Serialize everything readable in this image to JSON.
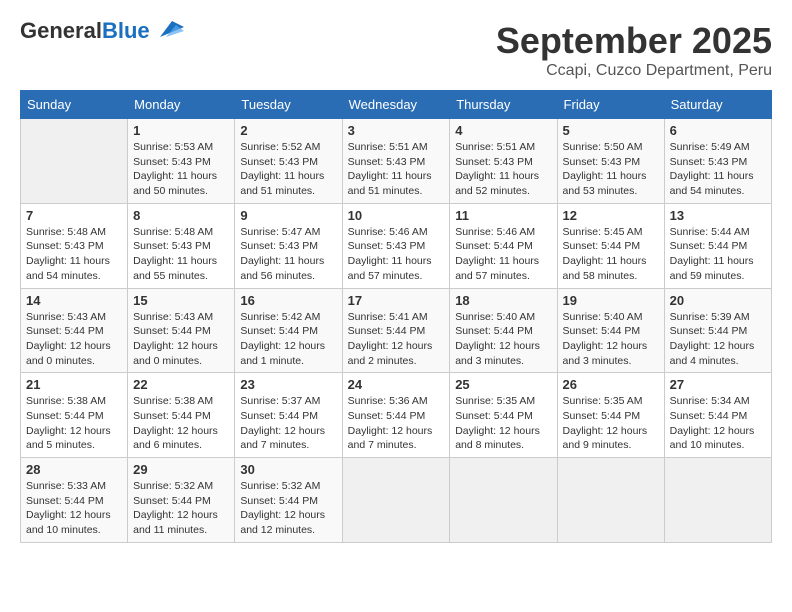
{
  "header": {
    "logo_general": "General",
    "logo_blue": "Blue",
    "month": "September 2025",
    "location": "Ccapi, Cuzco Department, Peru"
  },
  "weekdays": [
    "Sunday",
    "Monday",
    "Tuesday",
    "Wednesday",
    "Thursday",
    "Friday",
    "Saturday"
  ],
  "weeks": [
    [
      {
        "day": "",
        "detail": ""
      },
      {
        "day": "1",
        "detail": "Sunrise: 5:53 AM\nSunset: 5:43 PM\nDaylight: 11 hours\nand 50 minutes."
      },
      {
        "day": "2",
        "detail": "Sunrise: 5:52 AM\nSunset: 5:43 PM\nDaylight: 11 hours\nand 51 minutes."
      },
      {
        "day": "3",
        "detail": "Sunrise: 5:51 AM\nSunset: 5:43 PM\nDaylight: 11 hours\nand 51 minutes."
      },
      {
        "day": "4",
        "detail": "Sunrise: 5:51 AM\nSunset: 5:43 PM\nDaylight: 11 hours\nand 52 minutes."
      },
      {
        "day": "5",
        "detail": "Sunrise: 5:50 AM\nSunset: 5:43 PM\nDaylight: 11 hours\nand 53 minutes."
      },
      {
        "day": "6",
        "detail": "Sunrise: 5:49 AM\nSunset: 5:43 PM\nDaylight: 11 hours\nand 54 minutes."
      }
    ],
    [
      {
        "day": "7",
        "detail": "Sunrise: 5:48 AM\nSunset: 5:43 PM\nDaylight: 11 hours\nand 54 minutes."
      },
      {
        "day": "8",
        "detail": "Sunrise: 5:48 AM\nSunset: 5:43 PM\nDaylight: 11 hours\nand 55 minutes."
      },
      {
        "day": "9",
        "detail": "Sunrise: 5:47 AM\nSunset: 5:43 PM\nDaylight: 11 hours\nand 56 minutes."
      },
      {
        "day": "10",
        "detail": "Sunrise: 5:46 AM\nSunset: 5:43 PM\nDaylight: 11 hours\nand 57 minutes."
      },
      {
        "day": "11",
        "detail": "Sunrise: 5:46 AM\nSunset: 5:44 PM\nDaylight: 11 hours\nand 57 minutes."
      },
      {
        "day": "12",
        "detail": "Sunrise: 5:45 AM\nSunset: 5:44 PM\nDaylight: 11 hours\nand 58 minutes."
      },
      {
        "day": "13",
        "detail": "Sunrise: 5:44 AM\nSunset: 5:44 PM\nDaylight: 11 hours\nand 59 minutes."
      }
    ],
    [
      {
        "day": "14",
        "detail": "Sunrise: 5:43 AM\nSunset: 5:44 PM\nDaylight: 12 hours\nand 0 minutes."
      },
      {
        "day": "15",
        "detail": "Sunrise: 5:43 AM\nSunset: 5:44 PM\nDaylight: 12 hours\nand 0 minutes."
      },
      {
        "day": "16",
        "detail": "Sunrise: 5:42 AM\nSunset: 5:44 PM\nDaylight: 12 hours\nand 1 minute."
      },
      {
        "day": "17",
        "detail": "Sunrise: 5:41 AM\nSunset: 5:44 PM\nDaylight: 12 hours\nand 2 minutes."
      },
      {
        "day": "18",
        "detail": "Sunrise: 5:40 AM\nSunset: 5:44 PM\nDaylight: 12 hours\nand 3 minutes."
      },
      {
        "day": "19",
        "detail": "Sunrise: 5:40 AM\nSunset: 5:44 PM\nDaylight: 12 hours\nand 3 minutes."
      },
      {
        "day": "20",
        "detail": "Sunrise: 5:39 AM\nSunset: 5:44 PM\nDaylight: 12 hours\nand 4 minutes."
      }
    ],
    [
      {
        "day": "21",
        "detail": "Sunrise: 5:38 AM\nSunset: 5:44 PM\nDaylight: 12 hours\nand 5 minutes."
      },
      {
        "day": "22",
        "detail": "Sunrise: 5:38 AM\nSunset: 5:44 PM\nDaylight: 12 hours\nand 6 minutes."
      },
      {
        "day": "23",
        "detail": "Sunrise: 5:37 AM\nSunset: 5:44 PM\nDaylight: 12 hours\nand 7 minutes."
      },
      {
        "day": "24",
        "detail": "Sunrise: 5:36 AM\nSunset: 5:44 PM\nDaylight: 12 hours\nand 7 minutes."
      },
      {
        "day": "25",
        "detail": "Sunrise: 5:35 AM\nSunset: 5:44 PM\nDaylight: 12 hours\nand 8 minutes."
      },
      {
        "day": "26",
        "detail": "Sunrise: 5:35 AM\nSunset: 5:44 PM\nDaylight: 12 hours\nand 9 minutes."
      },
      {
        "day": "27",
        "detail": "Sunrise: 5:34 AM\nSunset: 5:44 PM\nDaylight: 12 hours\nand 10 minutes."
      }
    ],
    [
      {
        "day": "28",
        "detail": "Sunrise: 5:33 AM\nSunset: 5:44 PM\nDaylight: 12 hours\nand 10 minutes."
      },
      {
        "day": "29",
        "detail": "Sunrise: 5:32 AM\nSunset: 5:44 PM\nDaylight: 12 hours\nand 11 minutes."
      },
      {
        "day": "30",
        "detail": "Sunrise: 5:32 AM\nSunset: 5:44 PM\nDaylight: 12 hours\nand 12 minutes."
      },
      {
        "day": "",
        "detail": ""
      },
      {
        "day": "",
        "detail": ""
      },
      {
        "day": "",
        "detail": ""
      },
      {
        "day": "",
        "detail": ""
      }
    ]
  ]
}
